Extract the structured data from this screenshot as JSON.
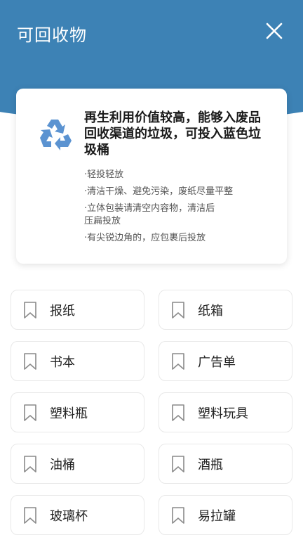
{
  "header": {
    "title": "可回收物",
    "bg_color": "#3d82b5",
    "close_icon": "close-icon"
  },
  "info_card": {
    "icon": "recycle-icon",
    "icon_color": "#5b93d1",
    "headline": "再生利用价值较高，能够入废品回收渠道的垃圾，可投入蓝色垃圾桶",
    "tips": [
      "·轻投轻放",
      "·清洁干燥、避免污染，废纸尽量平整",
      "·立体包装请清空内容物，清洁后压扁投放",
      "·有尖锐边角的，应包裹后投放"
    ]
  },
  "items": [
    {
      "label": "报纸",
      "icon": "bookmark-icon"
    },
    {
      "label": "纸箱",
      "icon": "bookmark-icon"
    },
    {
      "label": "书本",
      "icon": "bookmark-icon"
    },
    {
      "label": "广告单",
      "icon": "bookmark-icon"
    },
    {
      "label": "塑料瓶",
      "icon": "bookmark-icon"
    },
    {
      "label": "塑料玩具",
      "icon": "bookmark-icon"
    },
    {
      "label": "油桶",
      "icon": "bookmark-icon"
    },
    {
      "label": "酒瓶",
      "icon": "bookmark-icon"
    },
    {
      "label": "玻璃杯",
      "icon": "bookmark-icon"
    },
    {
      "label": "易拉罐",
      "icon": "bookmark-icon"
    }
  ]
}
